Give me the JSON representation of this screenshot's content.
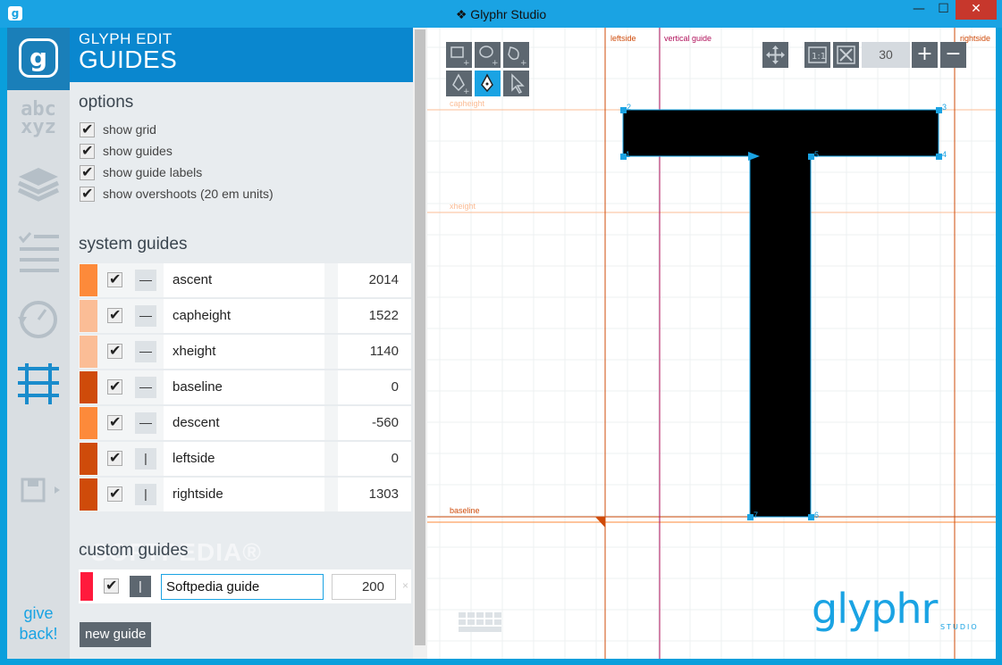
{
  "window": {
    "title": "❖ Glyphr Studio",
    "app_icon": "g",
    "min": "—",
    "max": "☐",
    "close": "✕"
  },
  "nav": {
    "logo": "g",
    "abc": "abc",
    "xyz": "xyz",
    "give": "give",
    "back": "back!"
  },
  "panel": {
    "subtitle": "GLYPH EDIT",
    "title": "GUIDES",
    "options_title": "options",
    "options": [
      "show grid",
      "show guides",
      "show guide labels",
      "show overshoots (20 em units)"
    ],
    "system_title": "system guides",
    "system_guides": [
      {
        "color": "#fd8a3a",
        "orient": "—",
        "name": "ascent",
        "value": "2014"
      },
      {
        "color": "#fbbd96",
        "orient": "—",
        "name": "capheight",
        "value": "1522"
      },
      {
        "color": "#fbbd96",
        "orient": "—",
        "name": "xheight",
        "value": "1140"
      },
      {
        "color": "#cf4b0a",
        "orient": "—",
        "name": "baseline",
        "value": "0"
      },
      {
        "color": "#fd8a3a",
        "orient": "—",
        "name": "descent",
        "value": "-560"
      },
      {
        "color": "#cf4b0a",
        "orient": "|",
        "name": "leftside",
        "value": "0"
      },
      {
        "color": "#cf4b0a",
        "orient": "|",
        "name": "rightside",
        "value": "1303"
      }
    ],
    "custom_title": "custom guides",
    "custom_guide": {
      "color": "#ff1a3c",
      "orient": "|",
      "name": "Softpedia guide",
      "value": "200",
      "delete": "×"
    },
    "new_guide": "new guide",
    "watermark": "SOFTPEDIA®"
  },
  "canvas": {
    "zoom": "30",
    "zoom_in": "+",
    "zoom_out": "−",
    "guide_labels": {
      "leftside": "leftside",
      "vertical": "vertical guide",
      "rightside": "rightside",
      "capheight": "capheight",
      "xheight": "xheight",
      "baseline": "baseline"
    },
    "point_labels": [
      "1",
      "2",
      "3",
      "4",
      "5",
      "6",
      "7",
      "8"
    ],
    "brand": "glyphr",
    "brand_sub": "STUDIO",
    "accent": "#1aa3e3"
  }
}
